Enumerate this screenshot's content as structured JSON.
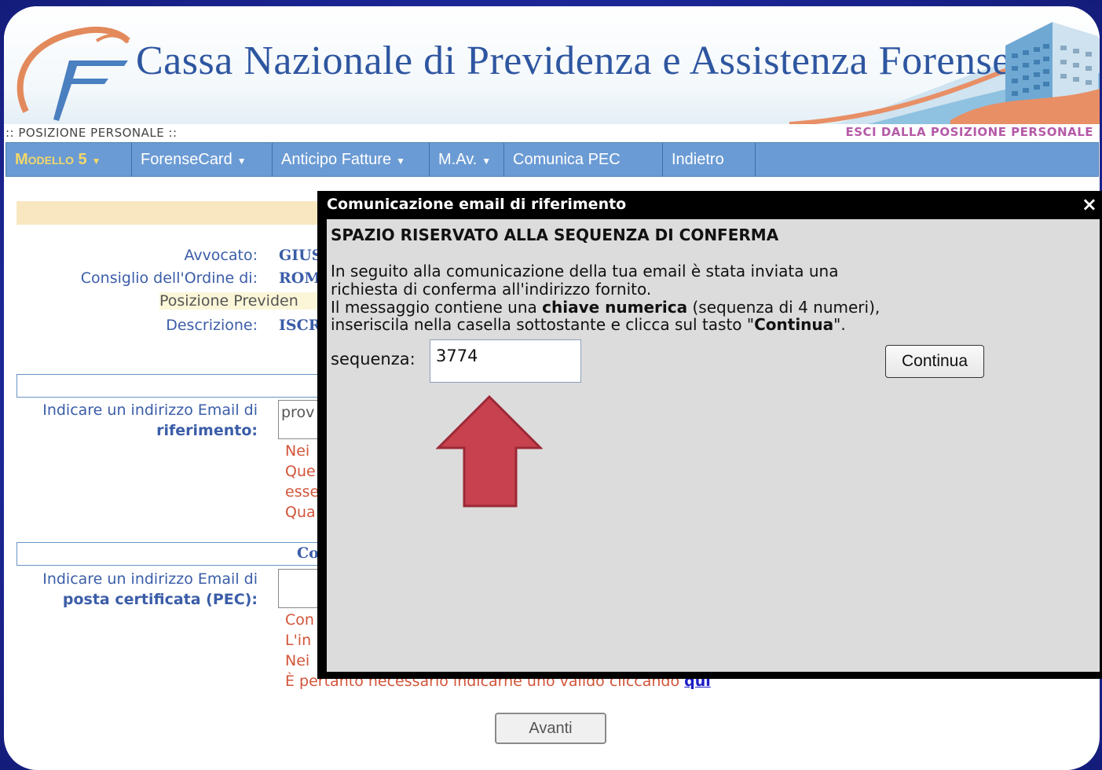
{
  "header": {
    "title": "Cassa Nazionale di Previdenza e Assistenza Forense",
    "section_label": ":: POSIZIONE PERSONALE ::",
    "exit_link": "ESCI DALLA POSIZIONE PERSONALE"
  },
  "nav": {
    "items": [
      {
        "label": "Modello 5",
        "dropdown": true
      },
      {
        "label": "ForenseCard",
        "dropdown": true
      },
      {
        "label": "Anticipo Fatture",
        "dropdown": true
      },
      {
        "label": "M.Av.",
        "dropdown": true
      },
      {
        "label": "Comunica PEC",
        "dropdown": false
      },
      {
        "label": "Indietro",
        "dropdown": false
      }
    ]
  },
  "background_form": {
    "avvocato_label": "Avvocato:",
    "avvocato_value": "GIUS",
    "consiglio_label": "Consiglio dell'Ordine di:",
    "consiglio_value": "ROM",
    "posizione_label": "Posizione Previden",
    "descrizione_label": "Descrizione:",
    "descrizione_value": "ISCR",
    "email_label_1": "Indicare un indirizzo Email di",
    "email_label_2": "riferimento:",
    "email_value": "prov",
    "email_note_1": "Nei",
    "email_note_2": "Que",
    "email_note_3": "esse",
    "email_note_4": "Qua",
    "pec_section_label": "Co",
    "pec_label_1": "Indicare un indirizzo Email di",
    "pec_label_2": "posta certificata (PEC):",
    "pec_note_1": "Con",
    "pec_note_2": "L'in",
    "pec_note_3": "Nei",
    "pec_note_4": "È pertanto necessario indicarne uno valido cliccando",
    "pec_note_link": "qui",
    "avanti_button": "Avanti"
  },
  "modal": {
    "title": "Comunicazione email di riferimento",
    "close_icon": "close-icon",
    "heading": "SPAZIO RISERVATO ALLA SEQUENZA DI CONFERMA",
    "line1": "In seguito alla comunicazione della tua email è stata inviata una",
    "line2": "richiesta di conferma all'indirizzo fornito.",
    "line3_pre": "Il messaggio contiene una ",
    "line3_bold": "chiave numerica",
    "line3_post": " (sequenza di 4 numeri),",
    "line4_pre": "inseriscila nella casella sottostante e clicca sul tasto \"",
    "line4_bold": "Continua",
    "line4_post": "\".",
    "sequence_label": "sequenza:",
    "sequence_value": "3774",
    "continue_button": "Continua"
  },
  "annotation": {
    "arrow": "up-arrow-icon",
    "color": "#c8414f"
  },
  "colors": {
    "nav_bg": "#6b9bd4",
    "nav_highlight": "#f2d86a",
    "title_blue": "#2e56a0",
    "note_red": "#d2553a",
    "exit_purple": "#b55aa8"
  }
}
